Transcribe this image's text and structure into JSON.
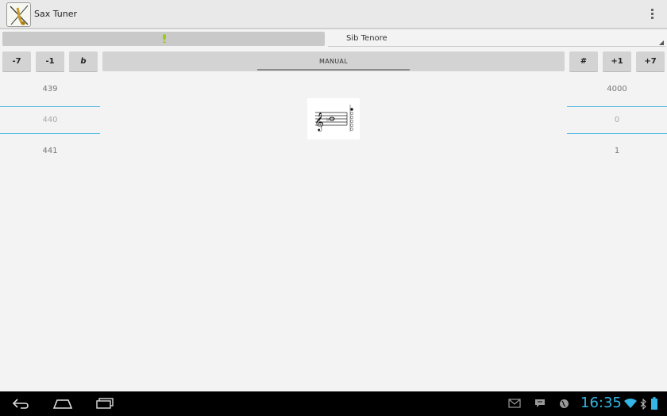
{
  "app": {
    "title": "Sax Tuner",
    "icon": "saxophone-icon"
  },
  "toolbar": {
    "overflow_icon": "overflow-menu-icon"
  },
  "level": {
    "mic_icon": "microphone-icon",
    "mic_color": "#9ccc1a"
  },
  "instrument": {
    "selected": "Sib Tenore"
  },
  "buttons": {
    "minus7": "-7",
    "minus1": "-1",
    "flat": "b",
    "manual": "MANUAL",
    "sharp": "#",
    "plus1": "+1",
    "plus7": "+7"
  },
  "left_picker": {
    "prev": "439",
    "current": "440",
    "next": "441"
  },
  "right_picker": {
    "prev": "4000",
    "current": "0",
    "next": "1"
  },
  "score": {
    "icon": "music-staff-icon"
  },
  "status_bar": {
    "time": "16:35",
    "accent": "#35b5e5",
    "icons": [
      "gmail-icon",
      "talk-icon",
      "globe-icon",
      "wifi-icon",
      "bluetooth-icon",
      "battery-icon"
    ]
  },
  "nav": {
    "icons": [
      "back-icon",
      "home-icon",
      "recent-apps-icon"
    ]
  }
}
